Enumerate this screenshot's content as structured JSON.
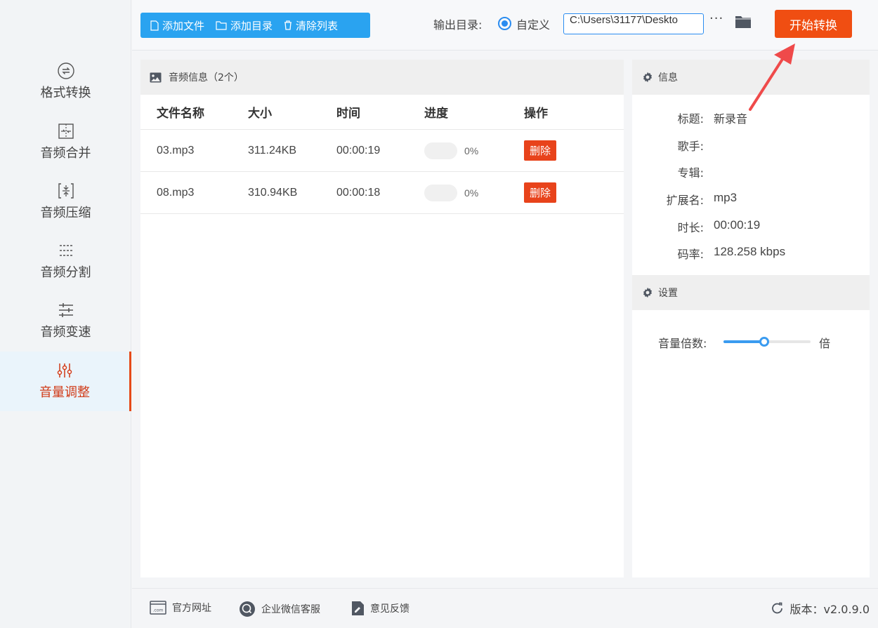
{
  "sidebar": {
    "items": [
      {
        "label": "格式转换",
        "icon": "format-convert-icon",
        "active": false
      },
      {
        "label": "音频合并",
        "icon": "merge-icon",
        "active": false
      },
      {
        "label": "音频压缩",
        "icon": "compress-icon",
        "active": false
      },
      {
        "label": "音频分割",
        "icon": "split-icon",
        "active": false
      },
      {
        "label": "音频变速",
        "icon": "speed-icon",
        "active": false
      },
      {
        "label": "音量调整",
        "icon": "volume-adjust-icon",
        "active": true
      }
    ]
  },
  "toolbar": {
    "add_file": "添加文件",
    "add_dir": "添加目录",
    "clear_list": "清除列表",
    "output_label": "输出目录:",
    "radio_label": "自定义",
    "output_path": "C:\\Users\\31177\\Deskto",
    "more": "···",
    "start": "开始转换"
  },
  "file_panel": {
    "title": "音频信息（2个）",
    "columns": [
      "文件名称",
      "大小",
      "时间",
      "进度",
      "操作"
    ],
    "rows": [
      {
        "name": "03.mp3",
        "size": "311.24KB",
        "time": "00:00:19",
        "progress": 0,
        "progress_text": "0%",
        "action": "删除"
      },
      {
        "name": "08.mp3",
        "size": "310.94KB",
        "time": "00:00:18",
        "progress": 0,
        "progress_text": "0%",
        "action": "删除"
      }
    ]
  },
  "info_panel": {
    "title": "信息",
    "fields": [
      {
        "key": "标题:",
        "value": "新录音"
      },
      {
        "key": "歌手:",
        "value": ""
      },
      {
        "key": "专辑:",
        "value": ""
      },
      {
        "key": "扩展名:",
        "value": "mp3"
      },
      {
        "key": "时长:",
        "value": "00:00:19"
      },
      {
        "key": "码率:",
        "value": "128.258 kbps"
      }
    ]
  },
  "settings_panel": {
    "title": "设置",
    "volume_label": "音量倍数:",
    "volume_unit": "倍",
    "volume_fraction": 0.47
  },
  "bottombar": {
    "website": "官方网址",
    "wechat": "企业微信客服",
    "feedback": "意见反馈",
    "version": "版本：v2.0.9.0"
  },
  "colors": {
    "accent_blue": "#2aa3f0",
    "start_orange": "#f04e12",
    "delete_red": "#e8431b",
    "active_text": "#d03a17",
    "arrow": "#ef4a4a"
  }
}
